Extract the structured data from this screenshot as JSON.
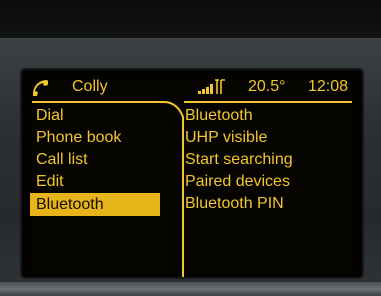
{
  "status": {
    "phone_icon": "phone-handset-icon",
    "caller": "Colly",
    "signal_icon": "signal-strength-icon",
    "temperature": "20.5°",
    "time": "12:08"
  },
  "colors": {
    "text": "#f2c62e",
    "highlight": "#e7b41a",
    "background": "#050400"
  },
  "menu": {
    "items": [
      {
        "label": "Dial"
      },
      {
        "label": "Phone book"
      },
      {
        "label": "Call list"
      },
      {
        "label": "Edit"
      },
      {
        "label": "Bluetooth",
        "selected": true
      }
    ]
  },
  "submenu": {
    "items": [
      {
        "label": "Bluetooth"
      },
      {
        "label": "UHP visible"
      },
      {
        "label": "Start searching"
      },
      {
        "label": "Paired devices"
      },
      {
        "label": "Bluetooth PIN"
      }
    ]
  }
}
